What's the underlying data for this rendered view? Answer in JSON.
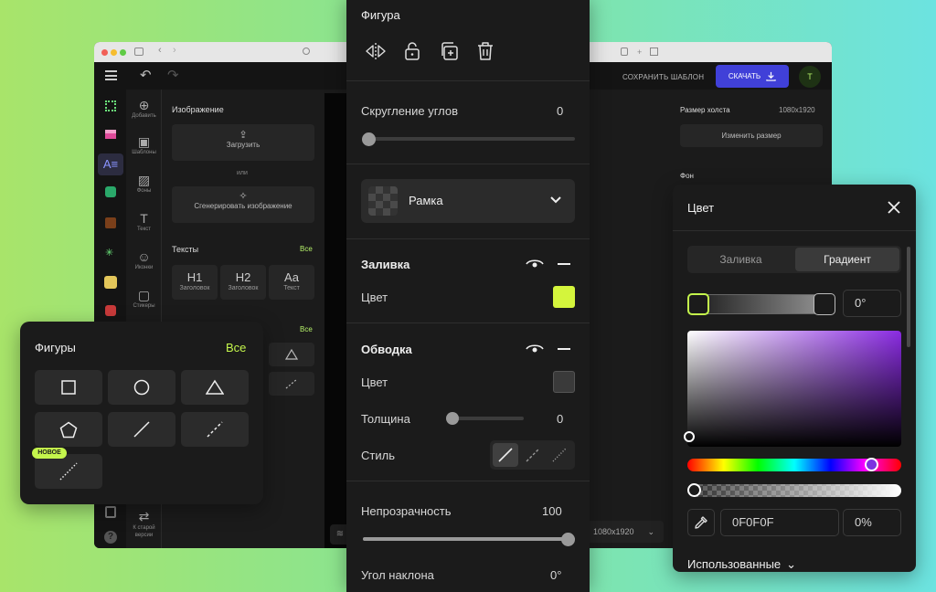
{
  "editor": {
    "save_template": "СОХРАНИТЬ ШАБЛОН",
    "download": "СКАЧАТЬ",
    "avatar_letter": "T",
    "categories": [
      "Добавить",
      "Шаблоны",
      "Фоны",
      "Текст",
      "Иконки",
      "Стикеры"
    ],
    "old_version": "К старой версии",
    "image_heading": "Изображение",
    "upload": "Загрузить",
    "or": "или",
    "generate": "Сгенерировать изображение",
    "texts_heading": "Тексты",
    "all": "Все",
    "text_cards": [
      {
        "glyph": "H1",
        "label": "Заголовок"
      },
      {
        "glyph": "H2",
        "label": "Заголовок"
      },
      {
        "glyph": "Aa",
        "label": "Текст"
      }
    ],
    "all2": "Все",
    "canvas_size_label": "Размер холста",
    "canvas_size_value": "1080x1920",
    "resize": "Изменить размер",
    "background_label": "Фон",
    "bottom_size": "1080x1920"
  },
  "figures": {
    "title": "Фигуры",
    "all": "Все",
    "new_badge": "НОВОЕ",
    "shapes": [
      "square",
      "circle",
      "triangle",
      "pentagon",
      "line",
      "dashed-line",
      "dotted-line"
    ]
  },
  "shape": {
    "title": "Фигура",
    "corner_label": "Скругление углов",
    "corner_value": "0",
    "corner_fraction": 0,
    "frame_label": "Рамка",
    "fill_label": "Заливка",
    "fill_color_label": "Цвет",
    "fill_color": "#d4f53c",
    "stroke_label": "Обводка",
    "stroke_color_label": "Цвет",
    "stroke_color": "#3a3a3a",
    "thickness_label": "Толщина",
    "thickness_value": "0",
    "style_label": "Стиль",
    "opacity_label": "Непрозрачность",
    "opacity_value": "100",
    "opacity_fraction": 1,
    "angle_label": "Угол наклона",
    "angle_value": "0°"
  },
  "color": {
    "title": "Цвет",
    "tabs": [
      "Заливка",
      "Градиент"
    ],
    "active_tab": "Градиент",
    "angle": "0°",
    "hex": "0F0F0F",
    "alpha": "0%",
    "used": "Использованные",
    "accent": "#c4f64c"
  }
}
